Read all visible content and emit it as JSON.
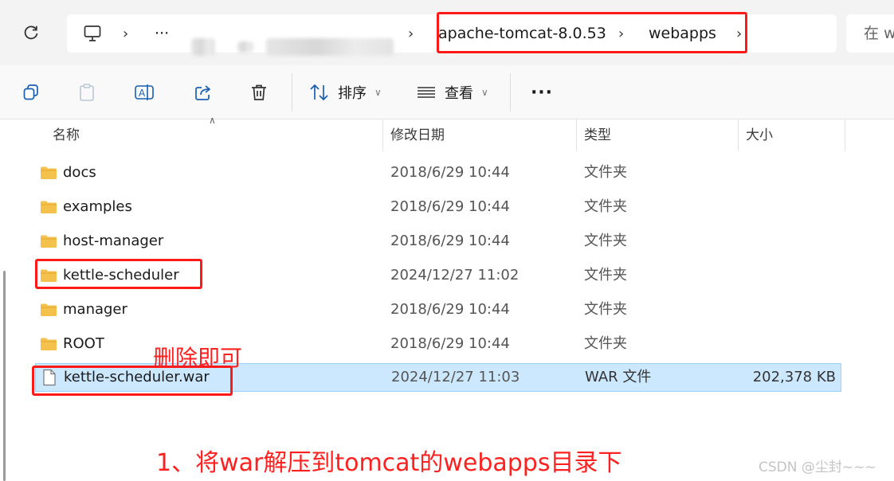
{
  "address_bar": {
    "segments": [
      "apache-tomcat-8.0.53",
      "webapps"
    ],
    "search_placeholder": "在 w",
    "more_label": "···"
  },
  "toolbar": {
    "sort_label": "排序",
    "view_label": "查看",
    "more_label": "···"
  },
  "columns": {
    "name": "名称",
    "modified": "修改日期",
    "type": "类型",
    "size": "大小"
  },
  "files": [
    {
      "name": "docs",
      "modified": "2018/6/29 10:44",
      "type": "文件夹",
      "size": "",
      "kind": "folder-icon"
    },
    {
      "name": "examples",
      "modified": "2018/6/29 10:44",
      "type": "文件夹",
      "size": "",
      "kind": "folder-icon"
    },
    {
      "name": "host-manager",
      "modified": "2018/6/29 10:44",
      "type": "文件夹",
      "size": "",
      "kind": "folder-icon"
    },
    {
      "name": "kettle-scheduler",
      "modified": "2024/12/27 11:02",
      "type": "文件夹",
      "size": "",
      "kind": "folder-icon"
    },
    {
      "name": "manager",
      "modified": "2018/6/29 10:44",
      "type": "文件夹",
      "size": "",
      "kind": "folder-icon"
    },
    {
      "name": "ROOT",
      "modified": "2018/6/29 10:44",
      "type": "文件夹",
      "size": "",
      "kind": "folder-icon"
    },
    {
      "name": "kettle-scheduler.war",
      "modified": "2024/12/27 11:03",
      "type": "WAR 文件",
      "size": "202,378 KB",
      "kind": "file-icon",
      "selected": true
    }
  ],
  "annotations": {
    "delete_note": "删除即可",
    "step_note": "1、将war解压到tomcat的webapps目录下"
  },
  "watermark": "CSDN @尘封~~~",
  "colors": {
    "folder": "#f5c14d",
    "selection": "#cce8ff",
    "annotation": "#ff2020"
  }
}
